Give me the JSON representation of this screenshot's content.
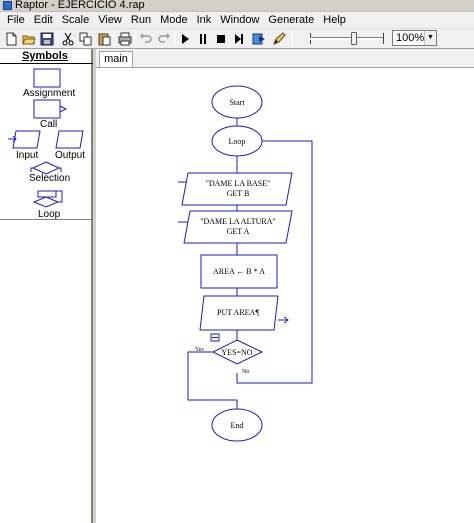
{
  "window": {
    "title": "Raptor - EJERCICIO 4.rap"
  },
  "menu": [
    "File",
    "Edit",
    "Scale",
    "View",
    "Run",
    "Mode",
    "Ink",
    "Window",
    "Generate",
    "Help"
  ],
  "toolbar": {
    "buttons": [
      "new-file-icon",
      "open-folder-icon",
      "save-icon",
      "cut-icon",
      "copy-icon",
      "paste-icon",
      "print-icon",
      "undo-icon",
      "redo-icon",
      "play-icon",
      "pause-icon",
      "stop-icon",
      "step-icon",
      "test-icon",
      "pen-icon"
    ],
    "zoom_value": "100%"
  },
  "symbols_panel": {
    "title": "Symbols",
    "items": [
      "Assignment",
      "Call",
      "Input",
      "Output",
      "Selection",
      "Loop"
    ]
  },
  "tabs": [
    {
      "label": "main"
    }
  ],
  "flowchart": {
    "start": "Start",
    "loop": "Loop",
    "input1_prompt": "\"DAME LA BASE\"",
    "input1_get": "GET B",
    "input2_prompt": "\"DAME LA ALTURA\"",
    "input2_get": "GET A",
    "assignment": "AREA ← B * A",
    "output": "PUT AREA¶",
    "condition": "YES=NO",
    "yes_label": "Yes",
    "no_label": "No",
    "end": "End"
  },
  "colors": {
    "flow_stroke": "#1a1ad6",
    "panel_bg": "#f0f0f0",
    "canvas_bg": "#ffffff"
  }
}
